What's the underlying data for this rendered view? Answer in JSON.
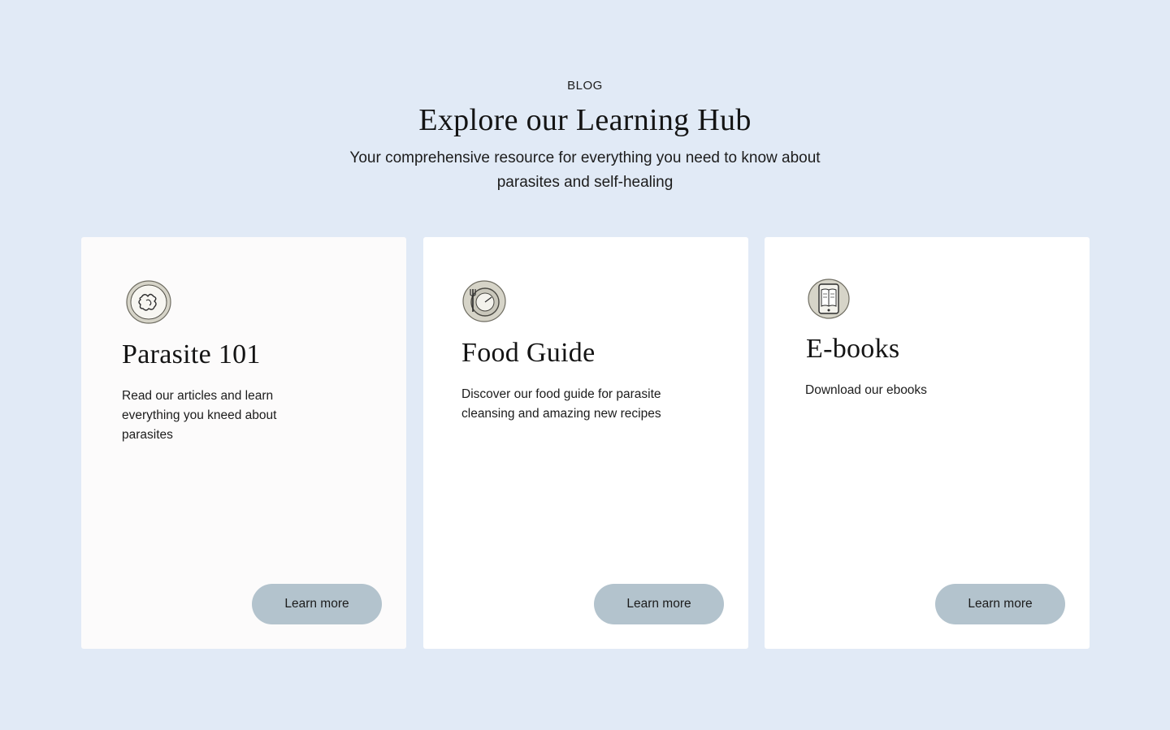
{
  "header": {
    "eyebrow": "BLOG",
    "title": "Explore our Learning Hub",
    "subtitle": "Your comprehensive resource for everything you need to know about parasites and self-healing"
  },
  "cards": [
    {
      "icon": "parasite-icon",
      "title": "Parasite 101",
      "description": "Read our articles and learn everything you kneed about parasites",
      "button_label": "Learn more"
    },
    {
      "icon": "plate-cutlery-icon",
      "title": "Food Guide",
      "description": "Discover our food guide for parasite cleansing and amazing new recipes",
      "button_label": "Learn more"
    },
    {
      "icon": "book-tablet-icon",
      "title": "E-books",
      "description": "Download our ebooks",
      "button_label": "Learn more"
    }
  ],
  "colors": {
    "page_background": "#e1eaf6",
    "card_background": "#ffffff",
    "button_background": "#b3c3cd",
    "icon_badge": "#d6d4c8"
  }
}
